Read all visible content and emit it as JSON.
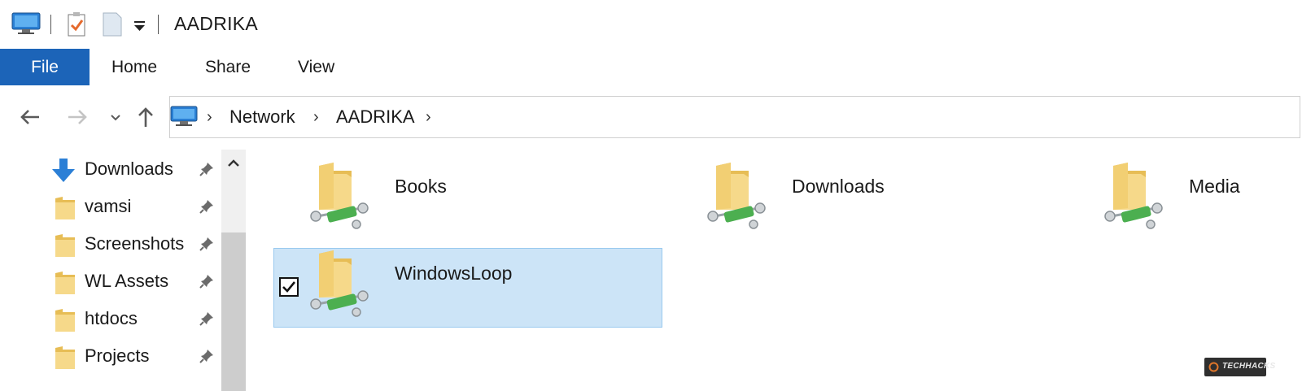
{
  "window": {
    "title": "AADRIKA"
  },
  "ribbon": {
    "tabs": [
      {
        "label": "File",
        "active": true
      },
      {
        "label": "Home"
      },
      {
        "label": "Share"
      },
      {
        "label": "View"
      }
    ]
  },
  "address": {
    "crumbs": [
      "Network",
      "AADRIKA"
    ]
  },
  "navpane": {
    "items": [
      {
        "label": "Downloads",
        "icon": "download-arrow-icon",
        "pinned": true
      },
      {
        "label": "vamsi",
        "icon": "folder-icon",
        "pinned": true
      },
      {
        "label": "Screenshots",
        "icon": "folder-icon",
        "pinned": true
      },
      {
        "label": "WL Assets",
        "icon": "folder-icon",
        "pinned": true
      },
      {
        "label": "htdocs",
        "icon": "folder-icon",
        "pinned": true
      },
      {
        "label": "Projects",
        "icon": "folder-icon",
        "pinned": true
      }
    ]
  },
  "content": {
    "shares": [
      {
        "label": "Books",
        "icon": "network-share-folder-icon"
      },
      {
        "label": "Downloads",
        "icon": "network-share-folder-icon"
      },
      {
        "label": "Media",
        "icon": "network-share-folder-icon"
      },
      {
        "label": "WindowsLoop",
        "icon": "network-share-folder-icon",
        "selected": true
      }
    ]
  },
  "watermark": {
    "text": "TECHHACKS"
  },
  "colors": {
    "accent": "#1c64b8",
    "selection": "#cce4f7",
    "folder": "#f2d27a"
  }
}
